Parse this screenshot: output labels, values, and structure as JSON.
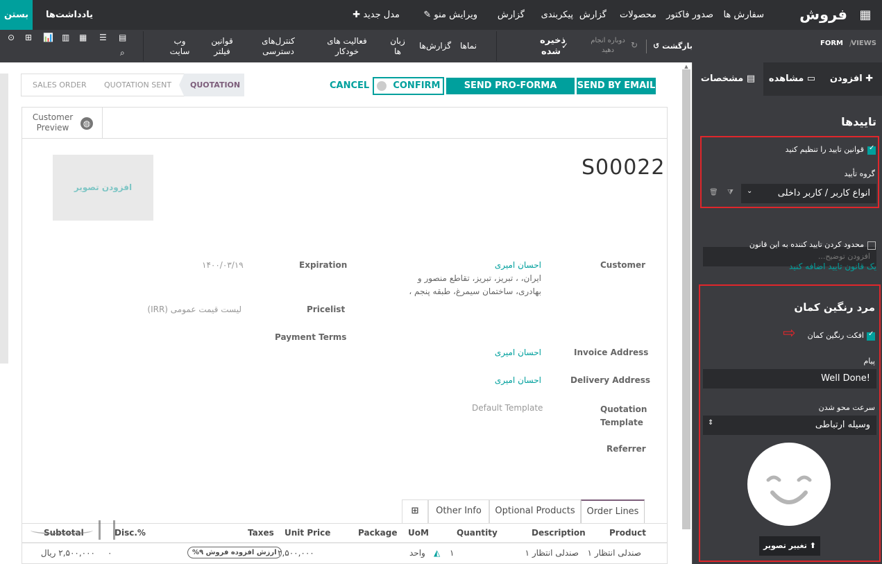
{
  "topbar": {
    "brand": "فروش",
    "menu": [
      "سفارش ها",
      "صدور فاکتور",
      "محصولات",
      "گزارش",
      "پیکربندی",
      "گزارش"
    ],
    "edit_menu": "ویرایش منو",
    "new_model": "مدل جدید",
    "notes": "یادداشت‌ها",
    "close": "بستن"
  },
  "subbar": {
    "breadcrumb_views": "VIEWS",
    "breadcrumb_form": "FORM",
    "undo": "بازگشت",
    "redo": "دوباره انجام دهید",
    "save": "ذخیره شده",
    "items": [
      "گزارش‌ها",
      "نماها",
      "زبان ها",
      "فعالیت های خودکار",
      "کنترل‌های دسترسی",
      "قوانین فیلتر",
      "وب سایت"
    ]
  },
  "panel": {
    "tabs": {
      "add": "افزودن",
      "view": "مشاهده",
      "properties": "مشخصات"
    },
    "approvals_title": "تاییدها",
    "approval_rules_label": "قوانین تایید را تنظیم کنید",
    "approval_group_label": "گروه تأیید",
    "approval_group_value": "انواع کاربر / کاربر داخلی",
    "desc_placeholder": "افزودن توضیح...",
    "limit_label": "محدود کردن تایید کننده به این قانون",
    "add_rule_link": "یک قانون تایید اضافه کنید",
    "rainbow_title": "مرد رنگین کمان",
    "rainbow_effect_label": "افکت رنگین کمان",
    "message_label": "پیام",
    "message_value": "Well Done!",
    "fade_label": "سرعت محو شدن",
    "fade_value": "وسیله ارتباطی",
    "change_image": "تغییر تصویر"
  },
  "form": {
    "status": [
      "SALES ORDER",
      "QUOTATION SENT",
      "QUOTATION"
    ],
    "cancel": "CANCEL",
    "confirm": "CONFIRM",
    "pro_forma": "SEND PRO-FORMA INVOICE",
    "send_email": "SEND BY EMAIL",
    "customer_preview": "Customer Preview",
    "add_image": "افزودن تصویر",
    "order_name": "S00022",
    "customer_label": "Customer",
    "customer_name": "احسان امیری",
    "customer_addr1": "ایران، ، تبریز، تبریز، تقاطع منصور و",
    "customer_addr2": "بهادری، ساختمان سیمرغ، طبقه پنجم ،",
    "invoice_address_label": "Invoice Address",
    "invoice_address_value": "احسان امیری",
    "delivery_address_label": "Delivery Address",
    "delivery_address_value": "احسان امیری",
    "quotation_template_label1": "Quotation",
    "quotation_template_label2": "Template",
    "quotation_template_value": "Default Template",
    "referrer_label": "Referrer",
    "expiration_label": "Expiration",
    "expiration_value": "۱۴۰۰/۰۳/۱۹",
    "pricelist_label": "Pricelist",
    "pricelist_value": "لیست قیمت عمومی (IRR)",
    "payment_terms_label": "Payment Terms",
    "notebook_tabs": [
      "Order Lines",
      "Optional Products",
      "Other Info"
    ],
    "columns": {
      "product": "Product",
      "description": "Description",
      "quantity": "Quantity",
      "uom": "UoM",
      "package": "Package",
      "unit_price": "Unit Price",
      "taxes": "Taxes",
      "disc": "Disc.%",
      "subtotal": "Subtotal"
    },
    "row": {
      "product": "صندلی انتظار ۱",
      "description": "صندلی انتظار ۱",
      "quantity": "۱",
      "uom": "واحد",
      "unit_price": "۲,۵۰۰,۰۰۰",
      "tax": "ارزش افزوده فروش ۹%",
      "disc": "۰",
      "subtotal": "۲,۵۰۰,۰۰۰ ریال"
    }
  },
  "colors": {
    "accent": "#00a09d",
    "dark": "#2f3033",
    "panel": "#3b3c40",
    "highlight": "#e0262b"
  }
}
